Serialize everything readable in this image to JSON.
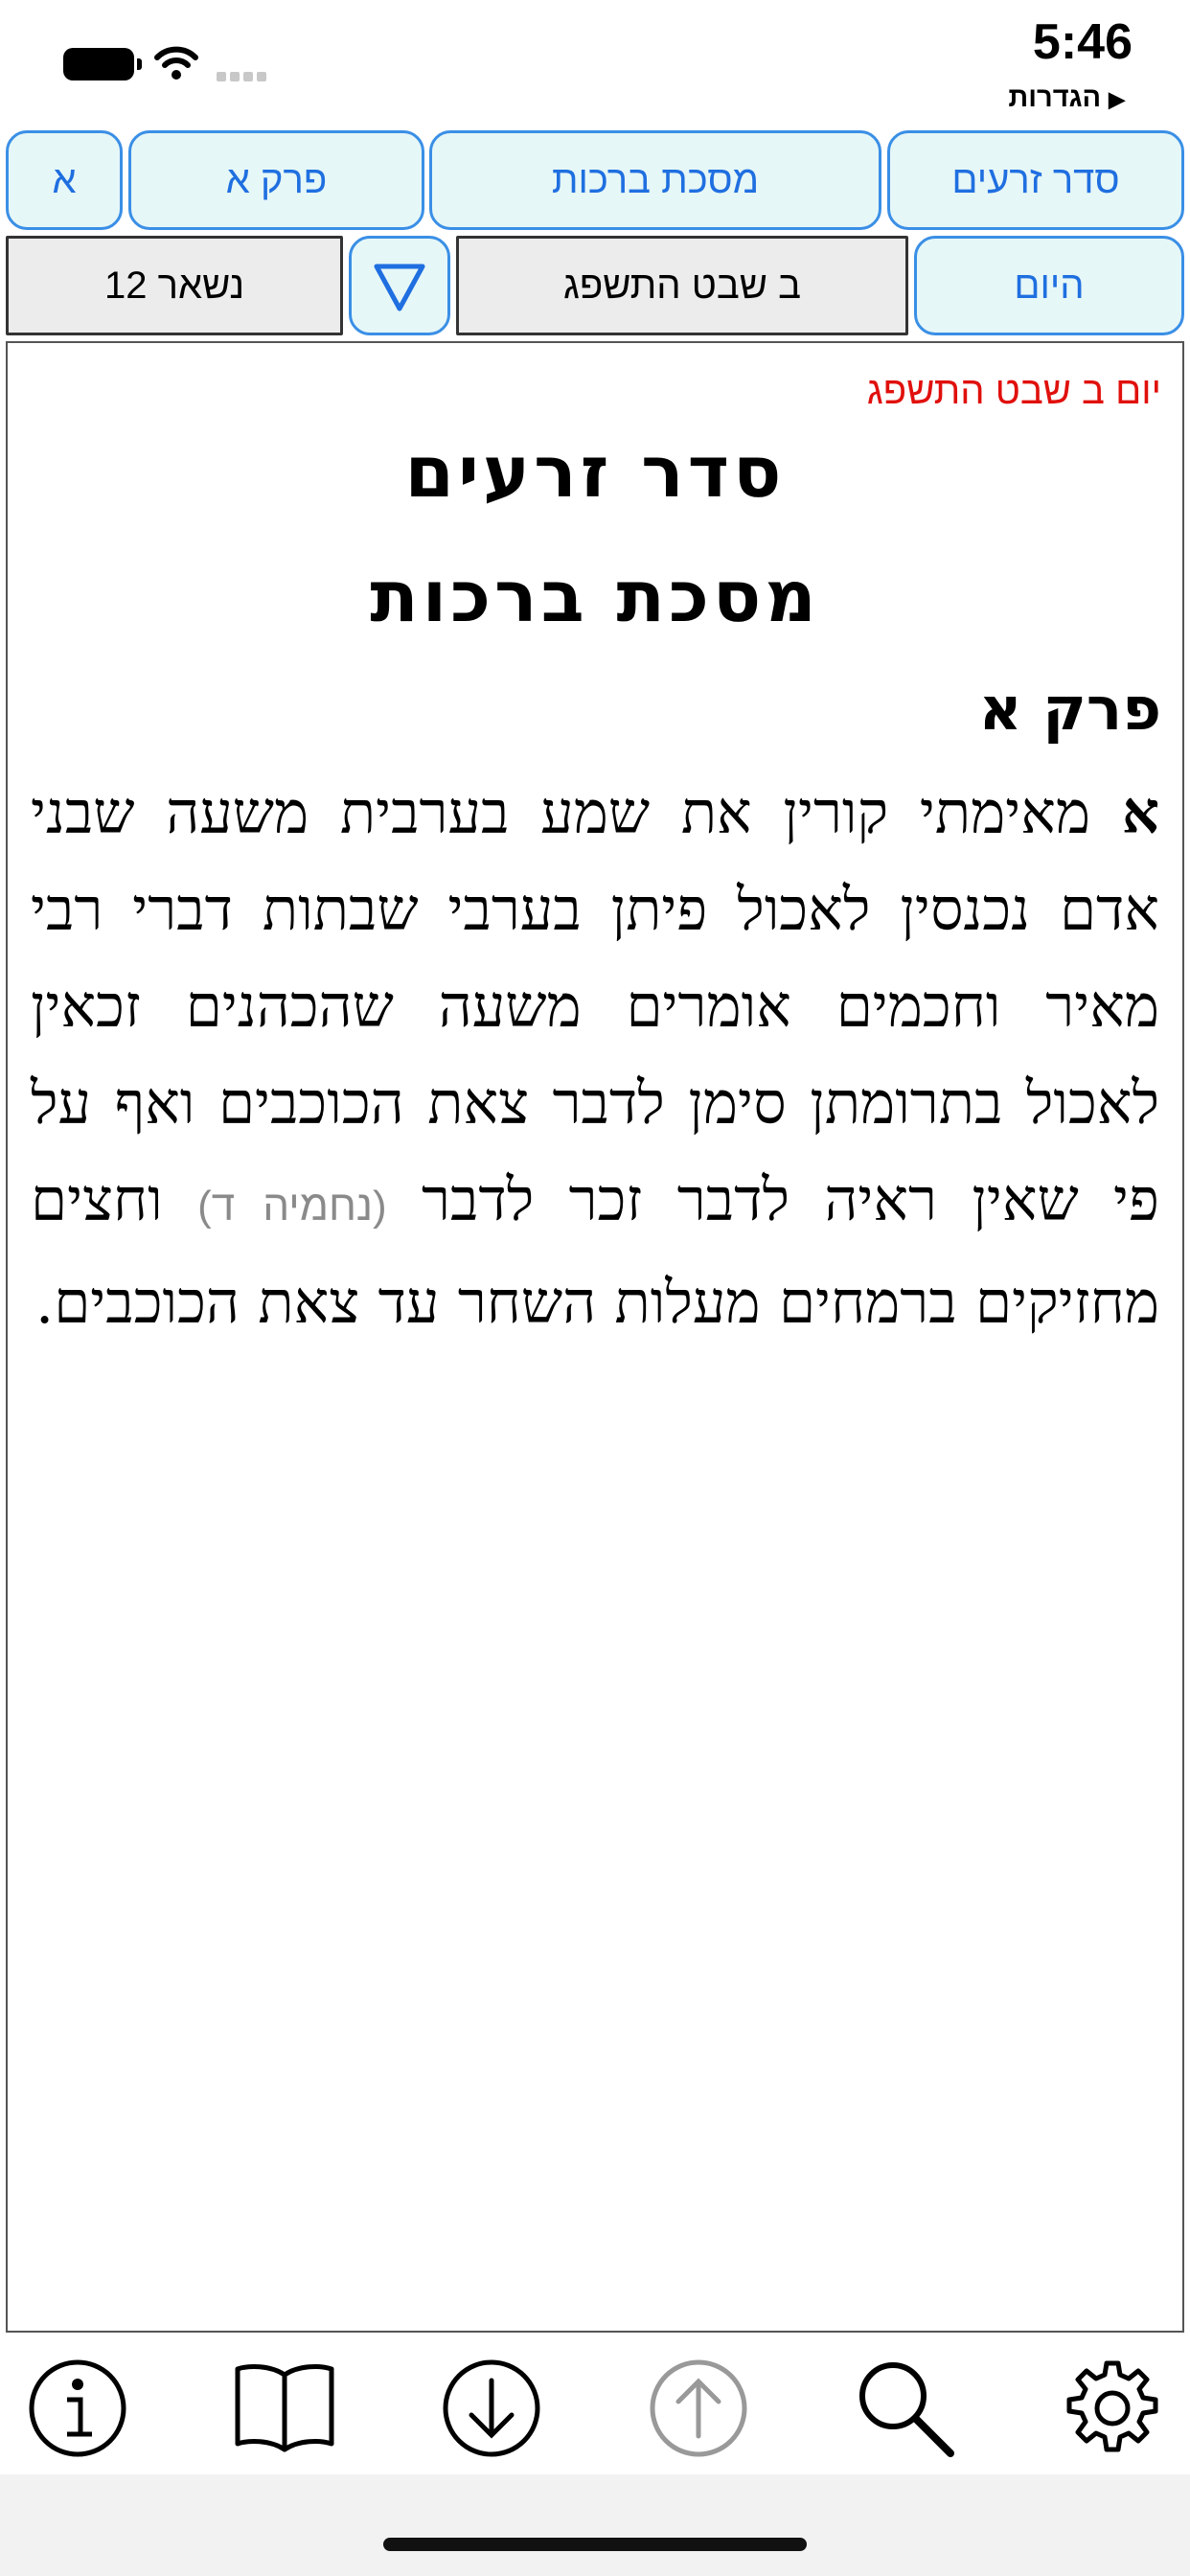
{
  "status": {
    "time": "5:46",
    "back_label": "הגדרות"
  },
  "nav": {
    "seder": "סדר זרעים",
    "masechet": "מסכת ברכות",
    "perek": "פרק א",
    "mishna": "א"
  },
  "controls": {
    "today": "היום",
    "date": "ב שבט התשפג",
    "remaining": "נשאר 12"
  },
  "content": {
    "date_line": "יום ב שבט התשפג",
    "seder_title": "סדר זרעים",
    "masechet_title": "מסכת ברכות",
    "perek_title": "פרק א",
    "mishna_letter": "א",
    "text_part1": " מאימתי קורין את שמע בערבית משעה שבני אדם נכנסין לאכול פיתן בערבי שבתות דברי רבי מאיר וחכמים אומרים משעה שהכהנים זכאין לאכול בתרומתן סימן לדבר צאת הכוכבים ואף על פי שאין ראיה לדבר זכר לדבר ",
    "reference": "(נחמיה ד)",
    "text_part2": " וחצים מחזיקים ברמחים מעלות השחר עד צאת הכוכבים."
  },
  "toolbar": {
    "icons": [
      "info-icon",
      "book-icon",
      "arrow-down-icon",
      "arrow-up-icon",
      "search-icon",
      "gear-icon"
    ]
  },
  "colors": {
    "accent": "#1f6fe0",
    "button_fill": "#e6f7f7",
    "date_red": "#e0100c"
  }
}
